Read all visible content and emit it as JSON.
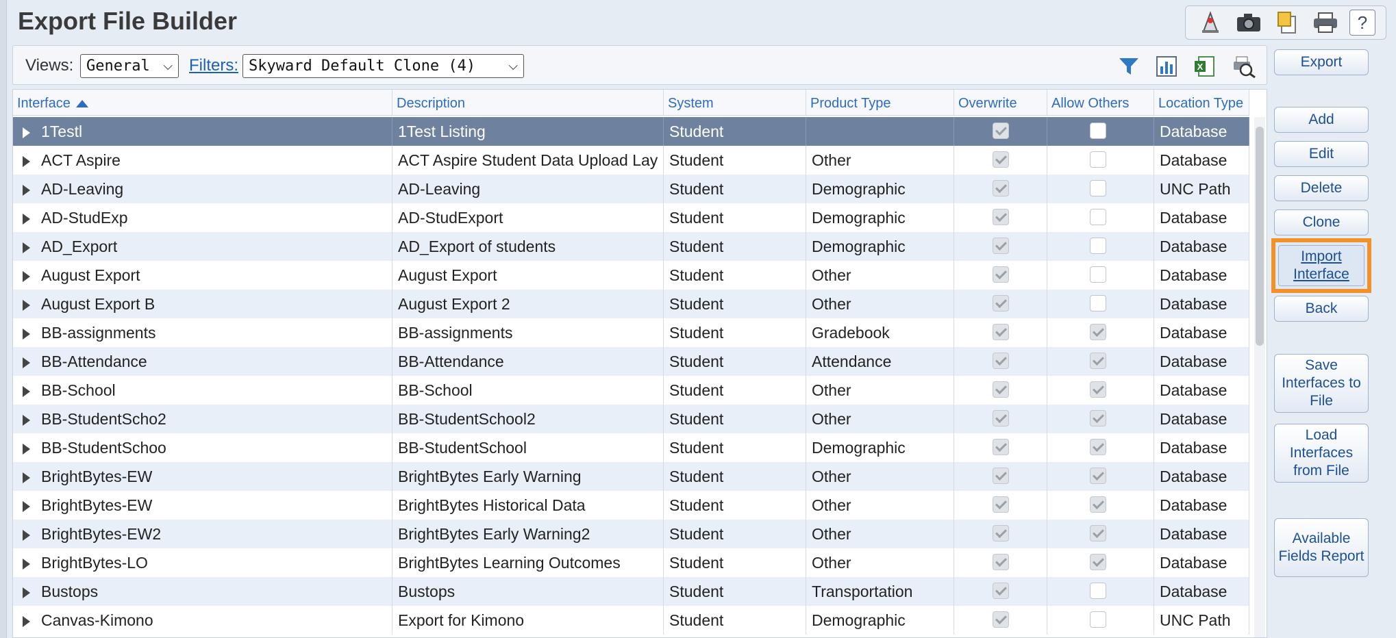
{
  "page": {
    "title": "Export File Builder"
  },
  "top_icons": [
    "map-marker-icon",
    "camera-icon",
    "notes-icon",
    "printer-icon",
    "help-icon"
  ],
  "top_help_label": "?",
  "toolbar": {
    "views_label": "Views:",
    "views_value": "General",
    "filters_label": "Filters:",
    "filters_value": "Skyward Default Clone (4)",
    "icons": [
      "filter-icon",
      "bar-chart-icon",
      "excel-icon",
      "print-preview-icon"
    ]
  },
  "grid": {
    "columns": [
      "Interface",
      "Description",
      "System",
      "Product Type",
      "Overwrite",
      "Allow Others",
      "Location Type"
    ],
    "sort_column": "Interface",
    "rows": [
      {
        "interface": "1Testl",
        "description": "1Test Listing",
        "system": "Student",
        "product_type": "",
        "overwrite": true,
        "allow_others": false,
        "location_type": "Database",
        "selected": true
      },
      {
        "interface": "ACT Aspire",
        "description": "ACT Aspire Student Data Upload Lay",
        "system": "Student",
        "product_type": "Other",
        "overwrite": true,
        "allow_others": false,
        "location_type": "Database"
      },
      {
        "interface": "AD-Leaving",
        "description": "AD-Leaving",
        "system": "Student",
        "product_type": "Demographic",
        "overwrite": true,
        "allow_others": false,
        "location_type": "UNC Path"
      },
      {
        "interface": "AD-StudExp",
        "description": "AD-StudExport",
        "system": "Student",
        "product_type": "Demographic",
        "overwrite": true,
        "allow_others": false,
        "location_type": "Database"
      },
      {
        "interface": "AD_Export",
        "description": "AD_Export of students",
        "system": "Student",
        "product_type": "Demographic",
        "overwrite": true,
        "allow_others": false,
        "location_type": "Database"
      },
      {
        "interface": "August Export",
        "description": "August Export",
        "system": "Student",
        "product_type": "Other",
        "overwrite": true,
        "allow_others": false,
        "location_type": "Database"
      },
      {
        "interface": "August Export B",
        "description": "August Export 2",
        "system": "Student",
        "product_type": "Other",
        "overwrite": true,
        "allow_others": false,
        "location_type": "Database"
      },
      {
        "interface": "BB-assignments",
        "description": "BB-assignments",
        "system": "Student",
        "product_type": "Gradebook",
        "overwrite": true,
        "allow_others": true,
        "location_type": "Database"
      },
      {
        "interface": "BB-Attendance",
        "description": "BB-Attendance",
        "system": "Student",
        "product_type": "Attendance",
        "overwrite": true,
        "allow_others": true,
        "location_type": "Database"
      },
      {
        "interface": "BB-School",
        "description": "BB-School",
        "system": "Student",
        "product_type": "Other",
        "overwrite": true,
        "allow_others": true,
        "location_type": "Database"
      },
      {
        "interface": "BB-StudentScho2",
        "description": "BB-StudentSchool2",
        "system": "Student",
        "product_type": "Other",
        "overwrite": true,
        "allow_others": true,
        "location_type": "Database"
      },
      {
        "interface": "BB-StudentSchoo",
        "description": "BB-StudentSchool",
        "system": "Student",
        "product_type": "Demographic",
        "overwrite": true,
        "allow_others": true,
        "location_type": "Database"
      },
      {
        "interface": "BrightBytes-EW",
        "description": "BrightBytes Early Warning",
        "system": "Student",
        "product_type": "Other",
        "overwrite": true,
        "allow_others": true,
        "location_type": "Database"
      },
      {
        "interface": "BrightBytes-EW",
        "description": "BrightBytes Historical Data",
        "system": "Student",
        "product_type": "Other",
        "overwrite": true,
        "allow_others": true,
        "location_type": "Database"
      },
      {
        "interface": "BrightBytes-EW2",
        "description": "BrightBytes Early Warning2",
        "system": "Student",
        "product_type": "Other",
        "overwrite": true,
        "allow_others": true,
        "location_type": "Database"
      },
      {
        "interface": "BrightBytes-LO",
        "description": "BrightBytes Learning Outcomes",
        "system": "Student",
        "product_type": "Other",
        "overwrite": true,
        "allow_others": true,
        "location_type": "Database"
      },
      {
        "interface": "Bustops",
        "description": "Bustops",
        "system": "Student",
        "product_type": "Transportation",
        "overwrite": true,
        "allow_others": false,
        "location_type": "Database"
      },
      {
        "interface": "Canvas-Kimono",
        "description": "Export for Kimono",
        "system": "Student",
        "product_type": "Demographic",
        "overwrite": true,
        "allow_others": false,
        "location_type": "UNC Path"
      }
    ]
  },
  "actions": {
    "export": "Export",
    "add": "Add",
    "edit": "Edit",
    "delete": "Delete",
    "clone": "Clone",
    "import_interface": "Import Interface",
    "back": "Back",
    "save_interfaces": "Save Interfaces to File",
    "load_interfaces": "Load Interfaces from File",
    "available_fields": "Available Fields Report"
  },
  "colors": {
    "accent": "#2e6bc0",
    "selected_row": "#6e819e",
    "highlight": "#f0912c"
  }
}
